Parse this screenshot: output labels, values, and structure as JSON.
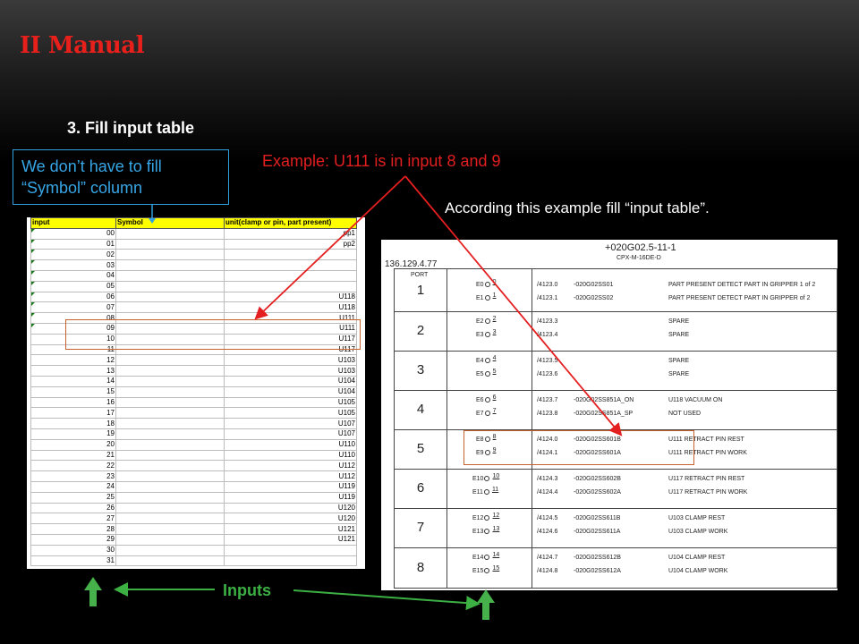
{
  "title": "II Manual",
  "step": "3. Fill input table",
  "note": {
    "line1": "We don’t have to fill",
    "line2": "“Symbol”  column"
  },
  "example": "Example:  U111 is in input 8 and 9",
  "according": "According  this example fill “input table”.",
  "inputs_label": "Inputs",
  "colors": {
    "title": "#e8201c",
    "note": "#37a6e6",
    "example": "#e41f1f",
    "inputs": "#3cb043",
    "highlight": "#c8622c",
    "header": "#ffff00"
  },
  "sheet": {
    "headers": [
      "input",
      "Symbol",
      "unit(clamp or pin, part present)"
    ],
    "rows": [
      [
        "00",
        "",
        "pp1"
      ],
      [
        "01",
        "",
        "pp2"
      ],
      [
        "02",
        "",
        ""
      ],
      [
        "03",
        "",
        ""
      ],
      [
        "04",
        "",
        ""
      ],
      [
        "05",
        "",
        ""
      ],
      [
        "06",
        "",
        "U118"
      ],
      [
        "07",
        "",
        "U118"
      ],
      [
        "08",
        "",
        "U111"
      ],
      [
        "09",
        "",
        "U111"
      ],
      [
        "10",
        "",
        "U117"
      ],
      [
        "11",
        "",
        "U117"
      ],
      [
        "12",
        "",
        "U103"
      ],
      [
        "13",
        "",
        "U103"
      ],
      [
        "14",
        "",
        "U104"
      ],
      [
        "15",
        "",
        "U104"
      ],
      [
        "16",
        "",
        "U105"
      ],
      [
        "17",
        "",
        "U105"
      ],
      [
        "18",
        "",
        "U107"
      ],
      [
        "19",
        "",
        "U107"
      ],
      [
        "20",
        "",
        "U110"
      ],
      [
        "21",
        "",
        "U110"
      ],
      [
        "22",
        "",
        "U112"
      ],
      [
        "23",
        "",
        "U112"
      ],
      [
        "24",
        "",
        "U119"
      ],
      [
        "25",
        "",
        "U119"
      ],
      [
        "26",
        "",
        "U120"
      ],
      [
        "27",
        "",
        "U120"
      ],
      [
        "28",
        "",
        "U121"
      ],
      [
        "29",
        "",
        "U121"
      ],
      [
        "30",
        "",
        ""
      ],
      [
        "31",
        "",
        ""
      ]
    ]
  },
  "diagram": {
    "title": "+020G02.5-11-1",
    "subtitle": "CPX-M-16DE-D",
    "ip": "136.129.4.77",
    "port_header": "PORT",
    "ports": [
      {
        "num": "1",
        "lines": [
          {
            "e": "E0",
            "pin": "0",
            "addr": "/4123.0",
            "tag": "-020G02SS01",
            "desc": "PART PRESENT DETECT PART IN GRIPPER 1 of 2"
          },
          {
            "e": "E1",
            "pin": "1",
            "addr": "/4123.1",
            "tag": "-020G02SS02",
            "desc": "PART PRESENT DETECT PART IN GRIPPER of 2"
          }
        ]
      },
      {
        "num": "2",
        "lines": [
          {
            "e": "E2",
            "pin": "2",
            "addr": "/4123.3",
            "tag": "",
            "desc": "SPARE"
          },
          {
            "e": "E3",
            "pin": "3",
            "addr": "/4123.4",
            "tag": "",
            "desc": "SPARE"
          }
        ]
      },
      {
        "num": "3",
        "lines": [
          {
            "e": "E4",
            "pin": "4",
            "addr": "/4123.5",
            "tag": "",
            "desc": "SPARE"
          },
          {
            "e": "E5",
            "pin": "5",
            "addr": "/4123.6",
            "tag": "",
            "desc": "SPARE"
          }
        ]
      },
      {
        "num": "4",
        "lines": [
          {
            "e": "E6",
            "pin": "6",
            "addr": "/4123.7",
            "tag": "-020G02SS851A_ON",
            "desc": "U118 VACUUM ON"
          },
          {
            "e": "E7",
            "pin": "7",
            "addr": "/4123.8",
            "tag": "-020G02SS851A_SP",
            "desc": "NOT USED"
          }
        ]
      },
      {
        "num": "5",
        "lines": [
          {
            "e": "E8",
            "pin": "8",
            "addr": "/4124.0",
            "tag": "-020G02SS601B",
            "desc": "U111 RETRACT PIN REST"
          },
          {
            "e": "E9",
            "pin": "9",
            "addr": "/4124.1",
            "tag": "-020G02SS601A",
            "desc": "U111 RETRACT PIN WORK"
          }
        ]
      },
      {
        "num": "6",
        "lines": [
          {
            "e": "E10",
            "pin": "10",
            "addr": "/4124.3",
            "tag": "-020G02SS602B",
            "desc": "U117 RETRACT PIN REST"
          },
          {
            "e": "E11",
            "pin": "11",
            "addr": "/4124.4",
            "tag": "-020G02SS602A",
            "desc": "U117 RETRACT PIN WORK"
          }
        ]
      },
      {
        "num": "7",
        "lines": [
          {
            "e": "E12",
            "pin": "12",
            "addr": "/4124.5",
            "tag": "-020G02SS611B",
            "desc": "U103 CLAMP REST"
          },
          {
            "e": "E13",
            "pin": "13",
            "addr": "/4124.6",
            "tag": "-020G02SS611A",
            "desc": "U103 CLAMP WORK"
          }
        ]
      },
      {
        "num": "8",
        "lines": [
          {
            "e": "E14",
            "pin": "14",
            "addr": "/4124.7",
            "tag": "-020G02SS612B",
            "desc": "U104 CLAMP REST"
          },
          {
            "e": "E15",
            "pin": "15",
            "addr": "/4124.8",
            "tag": "-020G02SS612A",
            "desc": "U104 CLAMP WORK"
          }
        ]
      }
    ]
  }
}
